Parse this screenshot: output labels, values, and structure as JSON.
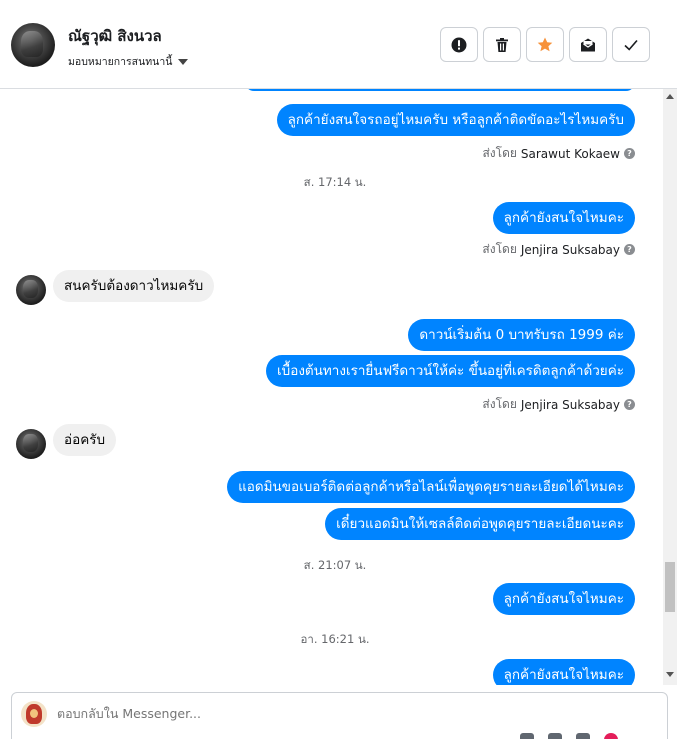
{
  "header": {
    "name": "ณัฐวุฒิ สิงนวล",
    "assign_label": "มอบหมายการสนทนานี้"
  },
  "actions": [
    {
      "name": "report-button",
      "icon": "exclamation-circle-icon"
    },
    {
      "name": "delete-button",
      "icon": "trash-icon"
    },
    {
      "name": "star-button",
      "icon": "star-icon"
    },
    {
      "name": "mark-unread-button",
      "icon": "envelope-icon"
    },
    {
      "name": "done-button",
      "icon": "check-icon"
    }
  ],
  "messages": {
    "m1": "ลูกค้ายังสนใจรถอยู่ไหมครับ หรือลูกค้าติดขัดอะไรไหมครับ",
    "sent1_label": "ส่งโดย",
    "sent1_name": "Sarawut Kokaew",
    "ts1": "ส. 17:14 น.",
    "m2": "ลูกค้ายังสนใจไหมคะ",
    "sent2_label": "ส่งโดย",
    "sent2_name": "Jenjira Suksabay",
    "in1": "สนครับต้องดาวไหมครับ",
    "m3": "ดาวน์เริ่มต้น 0 บาทรับรถ 1999 ค่ะ",
    "m4": "เบื้องต้นทางเรายื่นฟรีดาวน์ให้ค่ะ ขึ้นอยู่ที่เครดิตลูกค้าด้วยค่ะ",
    "sent3_label": "ส่งโดย",
    "sent3_name": "Jenjira Suksabay",
    "in2": "อ่อครับ",
    "m5": "แอดมินขอเบอร์ติดต่อลูกค้าหรือไลน์เพื่อพูดคุยรายละเอียดได้ไหมคะ",
    "m6": "เดี๋ยวแอดมินให้เซลล์ติดต่อพูดคุยรายละเอียดนะคะ",
    "ts2": "ส. 21:07 น.",
    "m7": "ลูกค้ายังสนใจไหมคะ",
    "ts3": "อา. 16:21 น.",
    "m8": "ลูกค้ายังสนใจไหมคะ"
  },
  "composer": {
    "placeholder": "ตอบกลับใน Messenger..."
  },
  "colors": {
    "outgoing_bubble": "#0084ff",
    "incoming_bubble": "#f0f0f0",
    "star": "#f7923a"
  }
}
